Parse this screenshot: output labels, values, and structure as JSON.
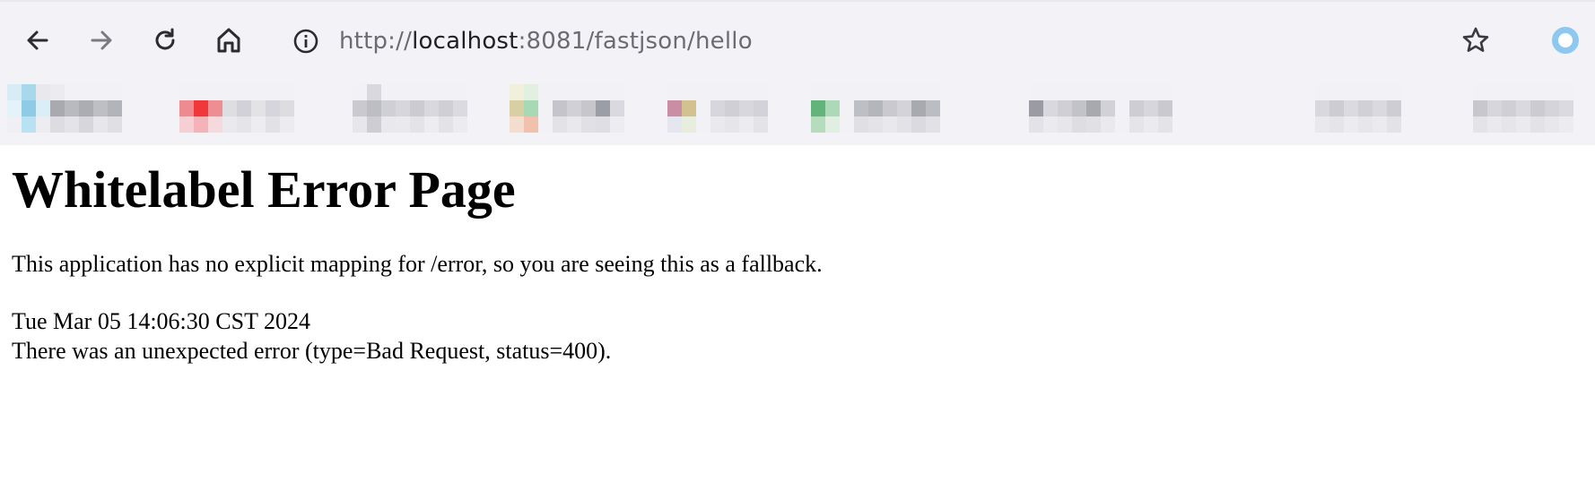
{
  "browser": {
    "url_scheme": "http://",
    "url_host": "localhost",
    "url_rest": ":8081/fastjson/hello",
    "icons": {
      "back": "arrow-left-icon",
      "forward": "arrow-right-icon",
      "reload": "reload-icon",
      "home": "home-icon",
      "site_info": "info-icon",
      "bookmark": "star-icon",
      "profile": "profile-ring-icon"
    },
    "accent_color": "#8ec8f0"
  },
  "page": {
    "title": "Whitelabel Error Page",
    "description": "This application has no explicit mapping for /error, so you are seeing this as a fallback.",
    "timestamp": "Tue Mar 05 14:06:30 CST 2024",
    "error_message": "There was an unexpected error (type=Bad Request, status=400)."
  }
}
